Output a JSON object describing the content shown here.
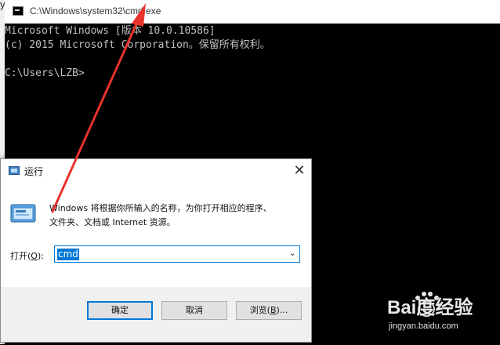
{
  "cmd_window": {
    "title": "C:\\Windows\\system32\\cmd.exe",
    "console_lines": [
      "Microsoft Windows [版本 10.0.10586]",
      "(c) 2015 Microsoft Corporation。保留所有权利。",
      "",
      "C:\\Users\\LZB>"
    ],
    "background": "#000000",
    "text_color": "#c0c0c0"
  },
  "background_fragment": {
    "glyph": "y"
  },
  "run_dialog": {
    "title": "运行",
    "close_glyph": "✕",
    "description_line1": "Windows 将根据你所输入的名称，为你打开相应的程序、",
    "description_line2": "文件夹、文档或 Internet 资源。",
    "open_label": "打开(",
    "open_label_key": "O",
    "open_label_end": "):",
    "open_value": "cmd",
    "buttons": {
      "ok": "确定",
      "cancel": "取消",
      "browse": "浏览(",
      "browse_key": "B",
      "browse_end": ")..."
    },
    "accent": "#0078d7"
  },
  "annotation": {
    "color": "#e8322b"
  },
  "watermark": {
    "brand": "Bai度经验",
    "url": "jingyan.baidu.com"
  }
}
